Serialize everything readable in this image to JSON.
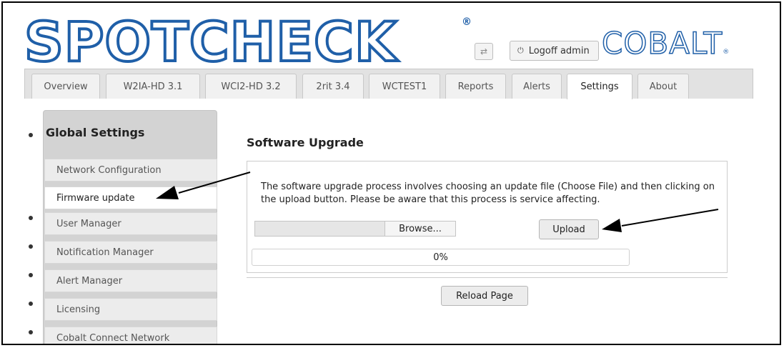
{
  "header": {
    "brand": "SPOTCHECK",
    "brand_mark": "®",
    "swap_icon": "swap-arrows-icon",
    "logoff_icon": "power-plug-icon",
    "logoff_label": "Logoff admin",
    "cobalt_logo": "COBALT",
    "cobalt_mark": "®",
    "brand_color": "#1f5fa8"
  },
  "tabs": [
    {
      "label": "Overview"
    },
    {
      "label": "W2IA-HD 3.1"
    },
    {
      "label": "WCI2-HD 3.2"
    },
    {
      "label": "2rit 3.4"
    },
    {
      "label": "WCTEST1"
    },
    {
      "label": "Reports"
    },
    {
      "label": "Alerts"
    },
    {
      "label": "Settings",
      "active": true
    },
    {
      "label": "About"
    }
  ],
  "sidebar": {
    "title": "Global Settings",
    "items": [
      {
        "label": "Network Configuration"
      },
      {
        "label": "Firmware update",
        "active": true
      },
      {
        "label": "User Manager"
      },
      {
        "label": "Notification Manager"
      },
      {
        "label": "Alert Manager"
      },
      {
        "label": "Licensing"
      },
      {
        "label": "Cobalt Connect Network"
      }
    ]
  },
  "main": {
    "section_title": "Software Upgrade",
    "description": "The software upgrade process involves choosing an update file (Choose File) and then clicking on the upload button. Please be aware that this process is service affecting.",
    "browse_label": "Browse...",
    "upload_label": "Upload",
    "progress_percent": 0,
    "progress_label": "0%",
    "reload_label": "Reload Page"
  }
}
